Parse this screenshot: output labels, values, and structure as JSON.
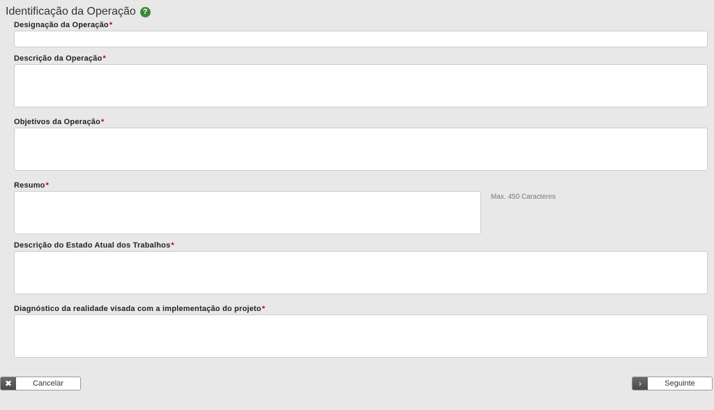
{
  "section": {
    "title": "Identificação da Operação",
    "helpGlyph": "?"
  },
  "fields": {
    "designacao": {
      "label": "Designação da Operação",
      "value": ""
    },
    "descricao": {
      "label": "Descrição da Operação",
      "value": ""
    },
    "objetivos": {
      "label": "Objetivos da Operação",
      "value": ""
    },
    "resumo": {
      "label": "Resumo",
      "value": "",
      "hint": "Max. 450 Caracteres"
    },
    "estado": {
      "label": "Descrição do Estado Atual dos Trabalhos",
      "value": ""
    },
    "diagnostico": {
      "label": "Diagnóstico da realidade visada com a implementação do projeto",
      "value": ""
    }
  },
  "footer": {
    "cancel": {
      "label": "Cancelar",
      "icon": "✖"
    },
    "next": {
      "label": "Seguinte",
      "icon": "›"
    }
  },
  "required": "*"
}
